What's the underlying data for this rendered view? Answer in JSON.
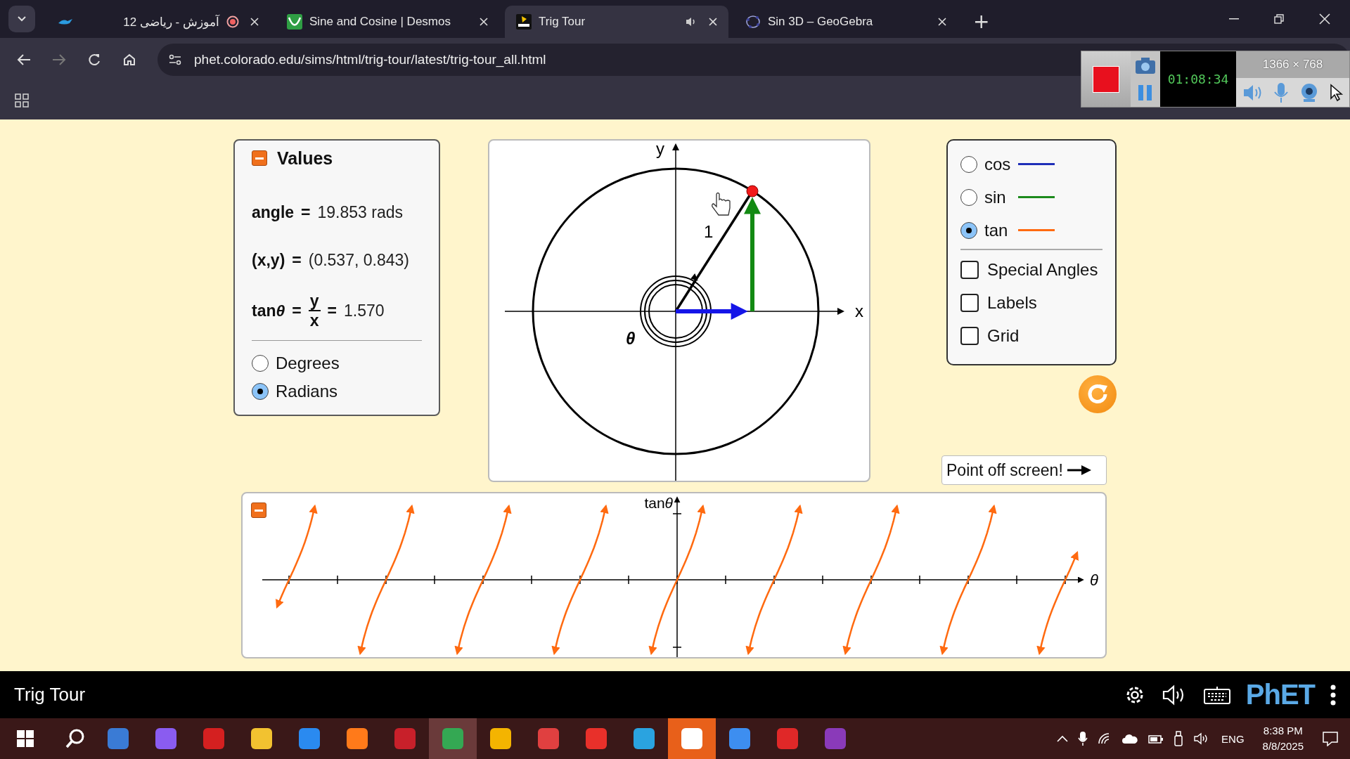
{
  "browser": {
    "tabs": [
      {
        "title": "آموزش - ریاضی 12",
        "selected": false,
        "kind": "recording"
      },
      {
        "title": "Sine and Cosine | Desmos",
        "selected": false,
        "kind": "desmos"
      },
      {
        "title": "Trig Tour",
        "selected": true,
        "kind": "phet"
      },
      {
        "title": "Sin 3D – GeoGebra",
        "selected": false,
        "kind": "geogebra"
      }
    ],
    "new_tab": "+",
    "url": "phet.colorado.edu/sims/html/trig-tour/latest/trig-tour_all.html"
  },
  "recorder": {
    "timer": "01:08:34",
    "resolution": "1366 × 768"
  },
  "values_panel": {
    "title": "Values",
    "expanded": true,
    "rows": [
      {
        "label": "angle",
        "equals": "=",
        "value": "19.853 rads"
      },
      {
        "label": "(x,y)",
        "equals": "=",
        "value": "(0.537, 0.843)"
      }
    ],
    "tan_row": {
      "label": "tan",
      "symbol": "θ",
      "equals": "=",
      "numerator": "y",
      "denominator": "x",
      "equals_2": "=",
      "value": "1.570"
    },
    "units": [
      {
        "label": "Degrees",
        "selected": false
      },
      {
        "label": "Radians",
        "selected": true
      }
    ]
  },
  "unit_circle": {
    "y_label": "y",
    "x_label": "x",
    "radius_label": "1",
    "angle_label": "θ"
  },
  "functions": [
    {
      "label": "cos",
      "color": "#1f2fb8",
      "selected": false
    },
    {
      "label": "sin",
      "color": "#1c8a1c",
      "selected": false
    },
    {
      "label": "tan",
      "color": "#ff6a10",
      "selected": true
    }
  ],
  "options": [
    {
      "label": "Special Angles",
      "checked": false
    },
    {
      "label": "Labels",
      "checked": false
    },
    {
      "label": "Grid",
      "checked": false
    }
  ],
  "point_off_screen": {
    "label": "Point off screen!"
  },
  "graph": {
    "expanded": true,
    "y_label": "tan",
    "y_symbol": "θ",
    "x_label": "θ"
  },
  "sim_bar": {
    "title": "Trig Tour",
    "logo": "PhET"
  },
  "taskbar": {
    "apps": [
      {
        "color": "#3a7bd5",
        "selected": false
      },
      {
        "color": "#8a5cf0",
        "selected": false
      },
      {
        "color": "#d42020",
        "selected": false
      },
      {
        "color": "#f2c230",
        "selected": false
      },
      {
        "color": "#2a8af0",
        "selected": false
      },
      {
        "color": "#ff7a1a",
        "selected": false
      },
      {
        "color": "#c8202a",
        "selected": false
      },
      {
        "color": "#34a853",
        "selected": true
      },
      {
        "color": "#f4b400",
        "selected": false
      },
      {
        "color": "#e04040",
        "selected": false
      },
      {
        "color": "#e8302a",
        "selected": false
      },
      {
        "color": "#2aa3e0",
        "selected": false
      },
      {
        "color": "#ffffff",
        "selected": true
      },
      {
        "color": "#3d8ef0",
        "selected": false
      },
      {
        "color": "#e02828",
        "selected": false
      },
      {
        "color": "#8a3ab9",
        "selected": false
      }
    ],
    "language": "ENG",
    "time": "8:38 PM",
    "date": "8/8/2025"
  }
}
